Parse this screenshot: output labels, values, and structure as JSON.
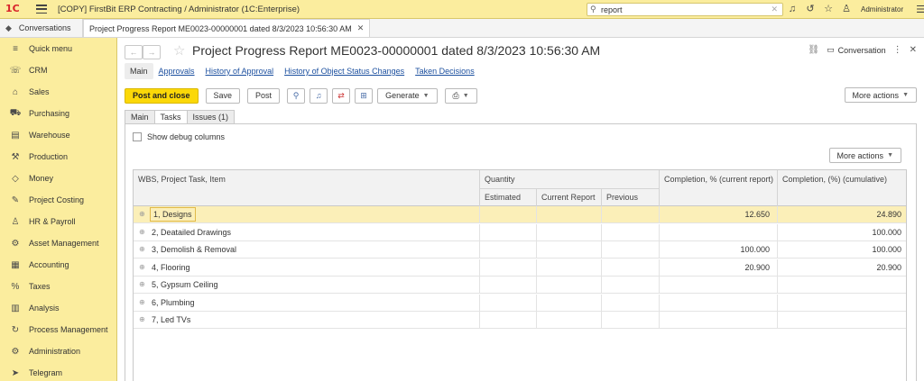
{
  "app": {
    "title": "[COPY] FirstBit ERP Contracting / Administrator  (1C:Enterprise)",
    "logo_text": "1С",
    "search_value": "report",
    "user": "Administrator"
  },
  "tabs": {
    "conversations": "Conversations",
    "document": "Project Progress Report ME0023-00000001 dated 8/3/2023 10:56:30 AM"
  },
  "sidebar": {
    "items": [
      {
        "label": "Quick menu",
        "icon": "≡"
      },
      {
        "label": "CRM",
        "icon": "☏"
      },
      {
        "label": "Sales",
        "icon": "⌂"
      },
      {
        "label": "Purchasing",
        "icon": "⛟"
      },
      {
        "label": "Warehouse",
        "icon": "▤"
      },
      {
        "label": "Production",
        "icon": "⚒"
      },
      {
        "label": "Money",
        "icon": "◇"
      },
      {
        "label": "Project Costing",
        "icon": "✎"
      },
      {
        "label": "HR & Payroll",
        "icon": "♙"
      },
      {
        "label": "Asset Management",
        "icon": "⚙"
      },
      {
        "label": "Accounting",
        "icon": "▦"
      },
      {
        "label": "Taxes",
        "icon": "%"
      },
      {
        "label": "Analysis",
        "icon": "▥"
      },
      {
        "label": "Process Management",
        "icon": "↻"
      },
      {
        "label": "Administration",
        "icon": "⚙"
      },
      {
        "label": "Telegram",
        "icon": "➤"
      }
    ]
  },
  "document": {
    "title": "Project Progress Report ME0023-00000001 dated 8/3/2023 10:56:30 AM",
    "conversation_label": "Conversation",
    "section_tabs": [
      "Main",
      "Approvals",
      "History of Approval",
      "History of Object Status Changes",
      "Taken Decisions"
    ]
  },
  "toolbar": {
    "post_and_close": "Post and close",
    "save": "Save",
    "post": "Post",
    "generate": "Generate",
    "more_actions": "More actions"
  },
  "inner_tabs": [
    "Main",
    "Tasks",
    "Issues (1)"
  ],
  "panel": {
    "show_debug_columns": "Show debug columns",
    "more_actions": "More actions"
  },
  "grid": {
    "headers": {
      "wbs": "WBS, Project Task, Item",
      "quantity": "Quantity",
      "estimated": "Estimated",
      "current_report": "Current Report",
      "previous": "Previous",
      "completion_current": "Completion, % (current report)",
      "completion_cumulative": "Completion, (%) (cumulative)"
    },
    "rows": [
      {
        "name": "1, Designs",
        "current": "12.650",
        "cumulative": "24.890"
      },
      {
        "name": "2, Deatailed Drawings",
        "current": "",
        "cumulative": "100.000"
      },
      {
        "name": "3, Demolish & Removal",
        "current": "100.000",
        "cumulative": "100.000"
      },
      {
        "name": "4, Flooring",
        "current": "20.900",
        "cumulative": "20.900"
      },
      {
        "name": "5, Gypsum Ceiling",
        "current": "",
        "cumulative": ""
      },
      {
        "name": "6, Plumbing",
        "current": "",
        "cumulative": ""
      },
      {
        "name": "7, Led TVs",
        "current": "",
        "cumulative": ""
      }
    ]
  }
}
